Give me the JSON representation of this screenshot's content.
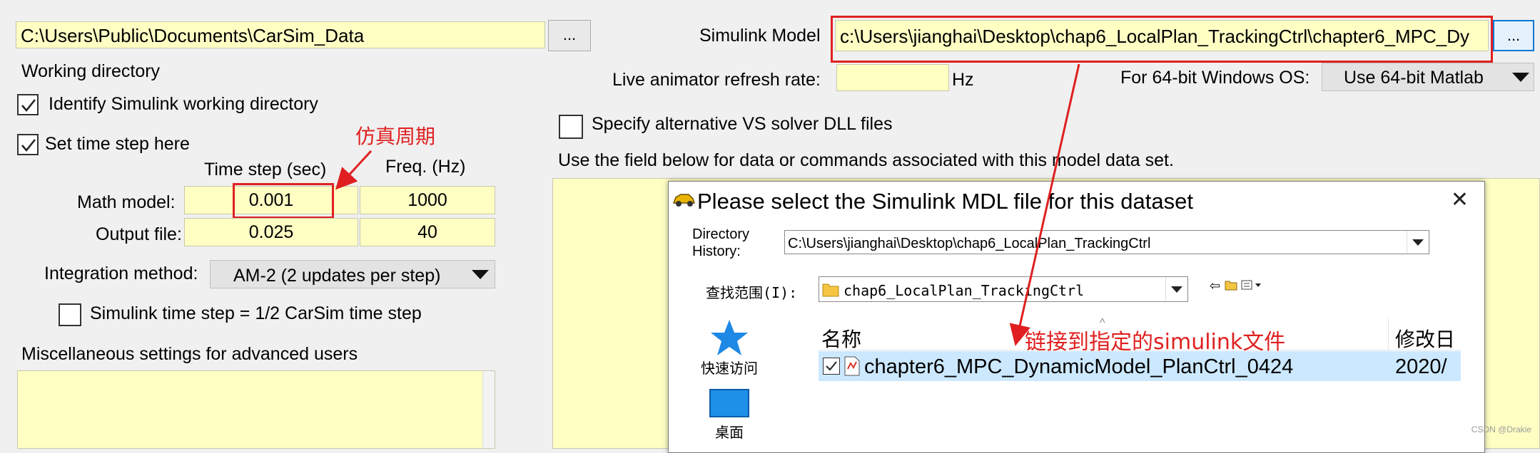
{
  "left": {
    "carsim_path": "C:\\Users\\Public\\Documents\\CarSim_Data",
    "browse_label": "...",
    "working_dir_label": "Working directory",
    "identify_label": "Identify Simulink working directory",
    "set_timestep_label": "Set time step here",
    "time_step_header": "Time step (sec)",
    "freq_header": "Freq. (Hz)",
    "math_model_label": "Math model:",
    "math_model_step": "0.001",
    "math_model_freq": "1000",
    "output_file_label": "Output file:",
    "output_file_step": "0.025",
    "output_file_freq": "40",
    "integration_label": "Integration method:",
    "integration_value": "AM-2 (2 updates per step)",
    "simulink_half_label": "Simulink time step = 1/2 CarSim time step",
    "misc_label": "Miscellaneous settings for advanced users"
  },
  "right": {
    "model_label": "Simulink Model",
    "model_path": "c:\\Users\\jianghai\\Desktop\\chap6_LocalPlan_TrackingCtrl\\chapter6_MPC_Dy",
    "model_browse_label": "...",
    "live_animator_label": "Live animator refresh rate:",
    "live_animator_value": "",
    "hz_unit": "Hz",
    "win64_label": "For 64-bit Windows OS:",
    "win64_value": "Use 64-bit Matlab",
    "alt_solver_label": "Specify alternative VS solver DLL files",
    "use_field_label": "Use the field below  for data or commands associated with this model data set."
  },
  "annotations": {
    "sim_period": "仿真周期",
    "link_simulink": "链接到指定的simulink文件"
  },
  "dialog": {
    "title": "Please select the Simulink MDL file for this dataset",
    "close_label": "✕",
    "dir_history_label_1": "Directory",
    "dir_history_label_2": "History:",
    "dir_history_value": "C:\\Users\\jianghai\\Desktop\\chap6_LocalPlan_TrackingCtrl",
    "look_in_label": "查找范围(I):",
    "look_in_value": "chap6_LocalPlan_TrackingCtrl",
    "col_name": "名称",
    "col_modified": "修改日",
    "quick_access_label": "快速访问",
    "desktop_label": "桌面",
    "file_name": "chapter6_MPC_DynamicModel_PlanCtrl_0424",
    "file_date": "2020/"
  },
  "watermark": "CSDN @Drakie",
  "colors": {
    "field_yellow": "#ffffc4",
    "annotation_red": "#e02020",
    "selection_blue": "#cce8ff"
  }
}
